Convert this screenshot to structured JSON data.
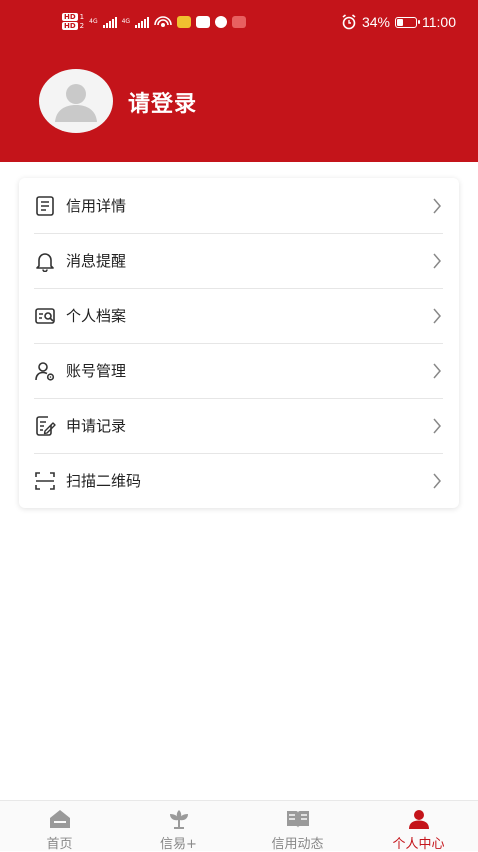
{
  "status_bar": {
    "network_left": "HD",
    "network_badge_1": "1",
    "network_badge_2": "2",
    "net_type_1": "4G",
    "net_type_2": "4G",
    "battery_percent": "34%",
    "time": "11:00"
  },
  "profile": {
    "login_prompt": "请登录"
  },
  "menu": {
    "items": [
      {
        "label": "信用详情",
        "icon": "document-list-icon"
      },
      {
        "label": "消息提醒",
        "icon": "bell-icon"
      },
      {
        "label": "个人档案",
        "icon": "profile-card-icon"
      },
      {
        "label": "账号管理",
        "icon": "user-gear-icon"
      },
      {
        "label": "申请记录",
        "icon": "edit-document-icon"
      },
      {
        "label": "扫描二维码",
        "icon": "scan-icon"
      }
    ]
  },
  "tabbar": {
    "tabs": [
      {
        "label": "首页",
        "icon": "home-icon",
        "active": false
      },
      {
        "label": "信易+",
        "icon": "flower-icon",
        "active": false
      },
      {
        "label": "信用动态",
        "icon": "book-icon",
        "active": false
      },
      {
        "label": "个人中心",
        "icon": "person-icon",
        "active": true
      }
    ]
  },
  "colors": {
    "brand_red": "#c4141a",
    "inactive_gray": "#888888"
  }
}
